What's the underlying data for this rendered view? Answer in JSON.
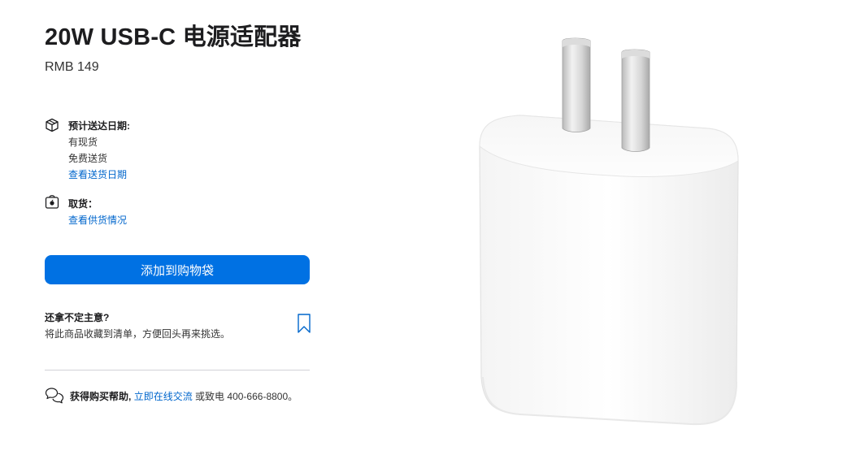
{
  "product": {
    "title": "20W USB-C 电源适配器",
    "price": "RMB 149"
  },
  "delivery": {
    "icon": "box-icon",
    "title": "预计送达日期:",
    "status": "有现货",
    "shipping": "免费送货",
    "link": "查看送货日期"
  },
  "pickup": {
    "icon": "apple-bag-icon",
    "title": "取货：",
    "link": "查看供货情况"
  },
  "actions": {
    "add_to_bag": "添加到购物袋",
    "add_to_bag_color": "#0071e3"
  },
  "save_for_later": {
    "title": "还拿不定主意?",
    "description": "将此商品收藏到清单，方便回头再来挑选。",
    "icon": "bookmark-icon"
  },
  "help": {
    "icon": "chat-bubbles-icon",
    "label": "获得购买帮助,",
    "chat_link": "立即在线交流",
    "or_call": "或致电",
    "phone": "400-666-8800。"
  },
  "colors": {
    "link": "#0066cc",
    "text": "#1d1d1f"
  }
}
